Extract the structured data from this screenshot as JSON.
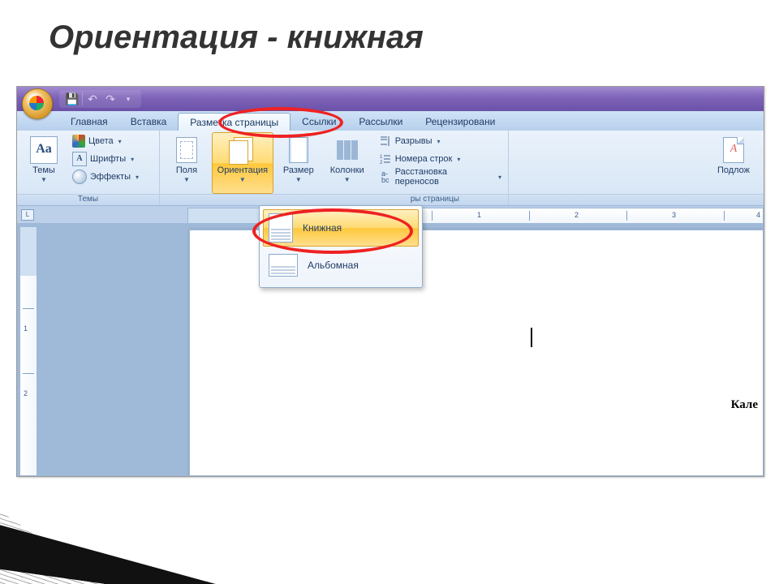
{
  "slide": {
    "title": "Ориентация - книжная"
  },
  "qat": {
    "save": "save-icon",
    "undo": "undo-icon",
    "redo": "redo-icon",
    "more": "more-icon"
  },
  "tabs": {
    "home": "Главная",
    "insert": "Вставка",
    "page_layout": "Разметка страницы",
    "references": "Ссылки",
    "mailings": "Рассылки",
    "review": "Рецензировани"
  },
  "themes": {
    "btn": "Темы",
    "colors": "Цвета",
    "fonts": "Шрифты",
    "effects": "Эффекты",
    "group_label": "Темы"
  },
  "page_setup": {
    "margins": "Поля",
    "orientation": "Ориентация",
    "size": "Размер",
    "columns": "Колонки",
    "breaks": "Разрывы",
    "line_numbers": "Номера строк",
    "hyphenation": "Расстановка переносов",
    "group_label_partial": "ры страницы"
  },
  "background": {
    "watermark": "Подлож"
  },
  "orientation_menu": {
    "portrait": "Книжная",
    "landscape": "Альбомная"
  },
  "ruler": {
    "n1": "1",
    "n2": "2",
    "n3": "3",
    "n4": "4"
  },
  "vruler": {
    "n1": "1",
    "n2": "2"
  },
  "doc": {
    "partial_text": "Кале"
  },
  "colors": {
    "accent": "#e22"
  }
}
